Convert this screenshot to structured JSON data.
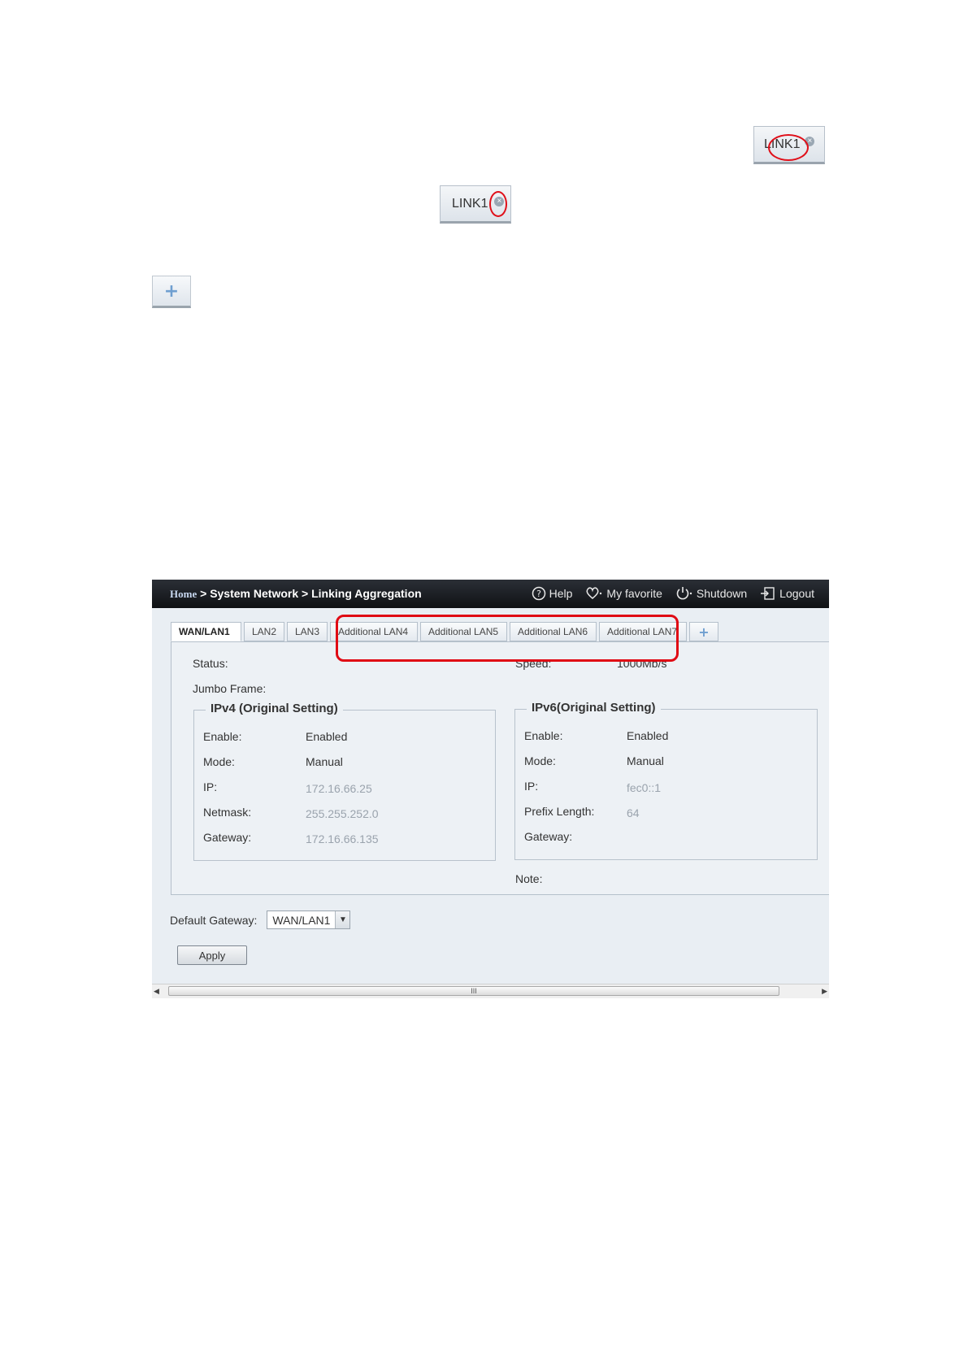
{
  "mini_tab_1": {
    "label": "LINK1"
  },
  "mini_tab_2": {
    "label": "LINK1"
  },
  "close_glyph": "×",
  "plus_glyph": "+",
  "icons": [
    "close-icon",
    "plus-icon",
    "help-icon",
    "heart-icon",
    "power-icon",
    "logout-icon",
    "dropdown-arrow-icon"
  ],
  "accent": {
    "highlight": "#e00a14",
    "topbar": "#1a1d22"
  },
  "header": {
    "home": "Home",
    "sep1": ">",
    "section": "System Network",
    "sep2": ">",
    "page": "Linking Aggregation",
    "help": "Help",
    "favorite": "My favorite",
    "shutdown": "Shutdown",
    "logout": "Logout"
  },
  "tabs": [
    "WAN/LAN1",
    "LAN2",
    "LAN3",
    "Additional LAN4",
    "Additional LAN5",
    "Additional LAN6",
    "Additional LAN7"
  ],
  "status": {
    "label": "Status:",
    "speed_label": "Speed:",
    "speed_value": "1000Mb/s",
    "jumbo_label": "Jumbo Frame:"
  },
  "ipv4": {
    "title": "IPv4 (Original Setting)",
    "enable_label": "Enable:",
    "enable_value": "Enabled",
    "mode_label": "Mode:",
    "mode_value": "Manual",
    "ip_label": "IP:",
    "ip_value": "172.16.66.25",
    "netmask_label": "Netmask:",
    "netmask_value": "255.255.252.0",
    "gateway_label": "Gateway:",
    "gateway_value": "172.16.66.135"
  },
  "ipv6": {
    "title": "IPv6(Original Setting)",
    "enable_label": "Enable:",
    "enable_value": "Enabled",
    "mode_label": "Mode:",
    "mode_value": "Manual",
    "ip_label": "IP:",
    "ip_value": "fec0::1",
    "prefix_label": "Prefix Length:",
    "prefix_value": "64",
    "gateway_label": "Gateway:"
  },
  "note_label": "Note:",
  "default_gateway": {
    "label": "Default Gateway:",
    "selected": "WAN/LAN1"
  },
  "apply_label": "Apply",
  "scroll_grip": "III"
}
